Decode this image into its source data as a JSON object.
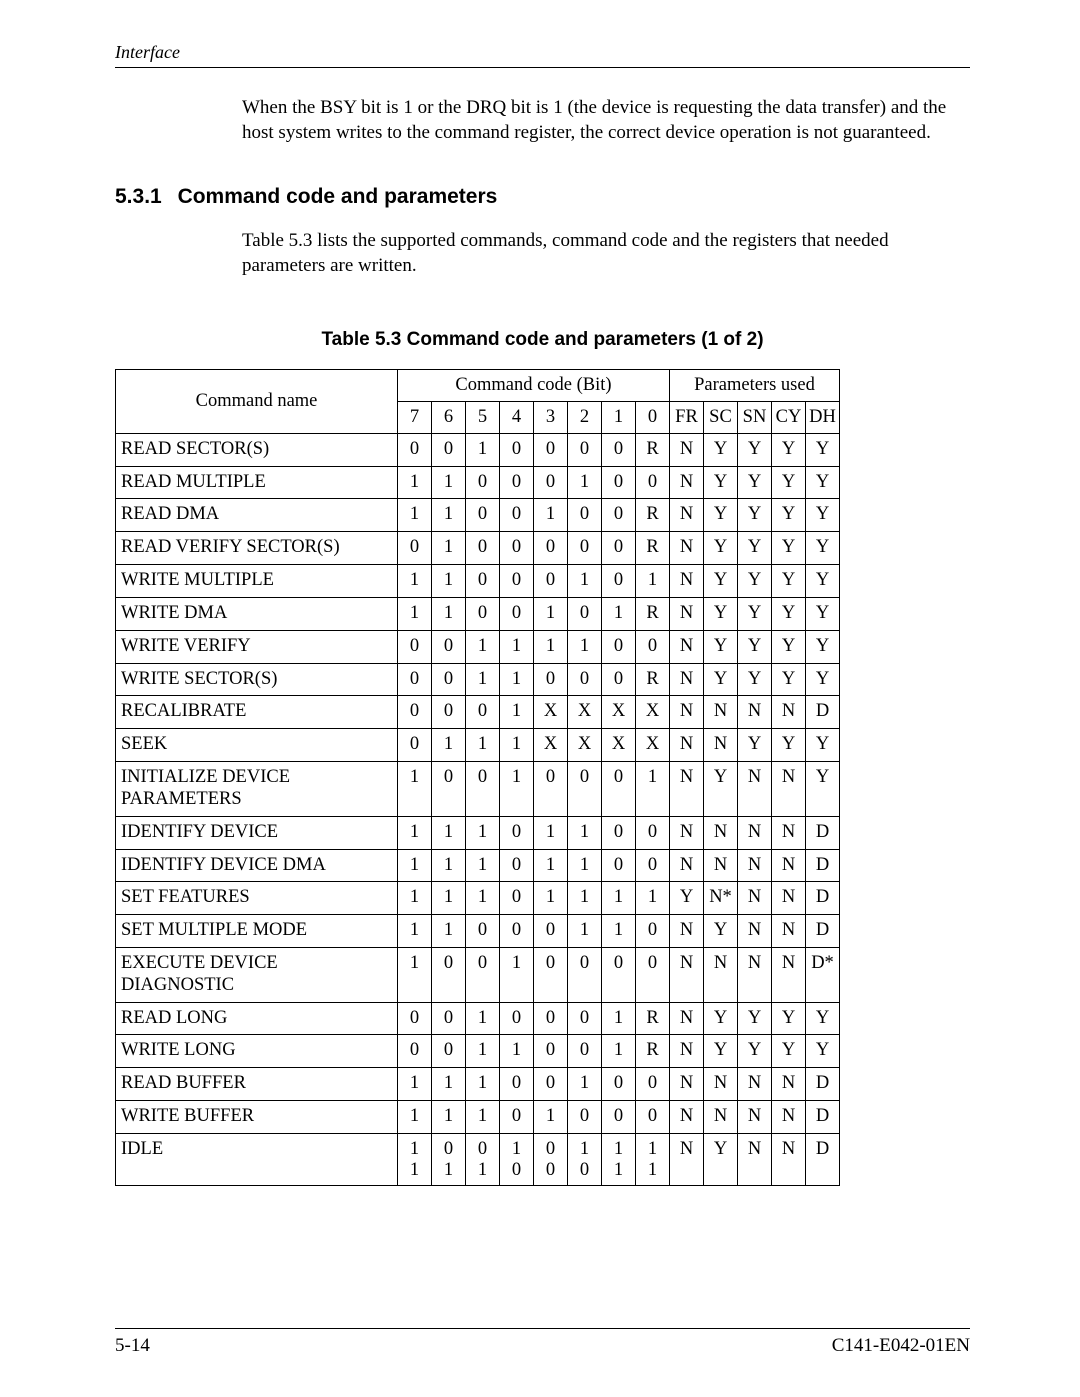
{
  "header": {
    "section": "Interface"
  },
  "intro": {
    "para1": "When the BSY bit is 1 or the DRQ bit is 1 (the device is requesting the data transfer) and the host system writes to the command register, the correct device operation is not guaranteed."
  },
  "section": {
    "number": "5.3.1",
    "title": "Command code and parameters",
    "para2": "Table 5.3 lists the supported commands, command code and the registers that needed parameters are written."
  },
  "table": {
    "caption": "Table 5.3   Command code and parameters (1 of 2)",
    "headers": {
      "command_name": "Command name",
      "code_group": "Command code (Bit)",
      "param_group": "Parameters used",
      "bits": [
        "7",
        "6",
        "5",
        "4",
        "3",
        "2",
        "1",
        "0"
      ],
      "params": [
        "FR",
        "SC",
        "SN",
        "CY",
        "DH"
      ]
    },
    "rows": [
      {
        "name": "READ SECTOR(S)",
        "bits": [
          "0",
          "0",
          "1",
          "0",
          "0",
          "0",
          "0",
          "R"
        ],
        "params": [
          "N",
          "Y",
          "Y",
          "Y",
          "Y"
        ]
      },
      {
        "name": "READ MULTIPLE",
        "bits": [
          "1",
          "1",
          "0",
          "0",
          "0",
          "1",
          "0",
          "0"
        ],
        "params": [
          "N",
          "Y",
          "Y",
          "Y",
          "Y"
        ]
      },
      {
        "name": "READ DMA",
        "bits": [
          "1",
          "1",
          "0",
          "0",
          "1",
          "0",
          "0",
          "R"
        ],
        "params": [
          "N",
          "Y",
          "Y",
          "Y",
          "Y"
        ]
      },
      {
        "name": "READ VERIFY SECTOR(S)",
        "bits": [
          "0",
          "1",
          "0",
          "0",
          "0",
          "0",
          "0",
          "R"
        ],
        "params": [
          "N",
          "Y",
          "Y",
          "Y",
          "Y"
        ]
      },
      {
        "name": "WRITE MULTIPLE",
        "bits": [
          "1",
          "1",
          "0",
          "0",
          "0",
          "1",
          "0",
          "1"
        ],
        "params": [
          "N",
          "Y",
          "Y",
          "Y",
          "Y"
        ]
      },
      {
        "name": "WRITE DMA",
        "bits": [
          "1",
          "1",
          "0",
          "0",
          "1",
          "0",
          "1",
          "R"
        ],
        "params": [
          "N",
          "Y",
          "Y",
          "Y",
          "Y"
        ]
      },
      {
        "name": "WRITE VERIFY",
        "bits": [
          "0",
          "0",
          "1",
          "1",
          "1",
          "1",
          "0",
          "0"
        ],
        "params": [
          "N",
          "Y",
          "Y",
          "Y",
          "Y"
        ]
      },
      {
        "name": "WRITE SECTOR(S)",
        "bits": [
          "0",
          "0",
          "1",
          "1",
          "0",
          "0",
          "0",
          "R"
        ],
        "params": [
          "N",
          "Y",
          "Y",
          "Y",
          "Y"
        ]
      },
      {
        "name": "RECALIBRATE",
        "bits": [
          "0",
          "0",
          "0",
          "1",
          "X",
          "X",
          "X",
          "X"
        ],
        "params": [
          "N",
          "N",
          "N",
          "N",
          "D"
        ]
      },
      {
        "name": "SEEK",
        "bits": [
          "0",
          "1",
          "1",
          "1",
          "X",
          "X",
          "X",
          "X"
        ],
        "params": [
          "N",
          "N",
          "Y",
          "Y",
          "Y"
        ]
      },
      {
        "name": "INITIALIZE DEVICE PARAMETERS",
        "bits": [
          "1",
          "0",
          "0",
          "1",
          "0",
          "0",
          "0",
          "1"
        ],
        "params": [
          "N",
          "Y",
          "N",
          "N",
          "Y"
        ]
      },
      {
        "name": "IDENTIFY DEVICE",
        "bits": [
          "1",
          "1",
          "1",
          "0",
          "1",
          "1",
          "0",
          "0"
        ],
        "params": [
          "N",
          "N",
          "N",
          "N",
          "D"
        ]
      },
      {
        "name": "IDENTIFY DEVICE DMA",
        "bits": [
          "1",
          "1",
          "1",
          "0",
          "1",
          "1",
          "0",
          "0"
        ],
        "params": [
          "N",
          "N",
          "N",
          "N",
          "D"
        ]
      },
      {
        "name": "SET FEATURES",
        "bits": [
          "1",
          "1",
          "1",
          "0",
          "1",
          "1",
          "1",
          "1"
        ],
        "params": [
          "Y",
          "N*",
          "N",
          "N",
          "D"
        ]
      },
      {
        "name": "SET MULTIPLE MODE",
        "bits": [
          "1",
          "1",
          "0",
          "0",
          "0",
          "1",
          "1",
          "0"
        ],
        "params": [
          "N",
          "Y",
          "N",
          "N",
          "D"
        ]
      },
      {
        "name": "EXECUTE DEVICE DIAGNOSTIC",
        "bits": [
          "1",
          "0",
          "0",
          "1",
          "0",
          "0",
          "0",
          "0"
        ],
        "params": [
          "N",
          "N",
          "N",
          "N",
          "D*"
        ]
      },
      {
        "name": "READ LONG",
        "bits": [
          "0",
          "0",
          "1",
          "0",
          "0",
          "0",
          "1",
          "R"
        ],
        "params": [
          "N",
          "Y",
          "Y",
          "Y",
          "Y"
        ]
      },
      {
        "name": "WRITE LONG",
        "bits": [
          "0",
          "0",
          "1",
          "1",
          "0",
          "0",
          "1",
          "R"
        ],
        "params": [
          "N",
          "Y",
          "Y",
          "Y",
          "Y"
        ]
      },
      {
        "name": "READ BUFFER",
        "bits": [
          "1",
          "1",
          "1",
          "0",
          "0",
          "1",
          "0",
          "0"
        ],
        "params": [
          "N",
          "N",
          "N",
          "N",
          "D"
        ]
      },
      {
        "name": "WRITE BUFFER",
        "bits": [
          "1",
          "1",
          "1",
          "0",
          "1",
          "0",
          "0",
          "0"
        ],
        "params": [
          "N",
          "N",
          "N",
          "N",
          "D"
        ]
      },
      {
        "name": "IDLE",
        "bits": [
          "1\n1",
          "0\n1",
          "0\n1",
          "1\n0",
          "0\n0",
          "1\n0",
          "1\n1",
          "1\n1"
        ],
        "params": [
          "N",
          "Y",
          "N",
          "N",
          "D"
        ]
      }
    ]
  },
  "footer": {
    "page_number": "5-14",
    "doc_id": "C141-E042-01EN"
  }
}
